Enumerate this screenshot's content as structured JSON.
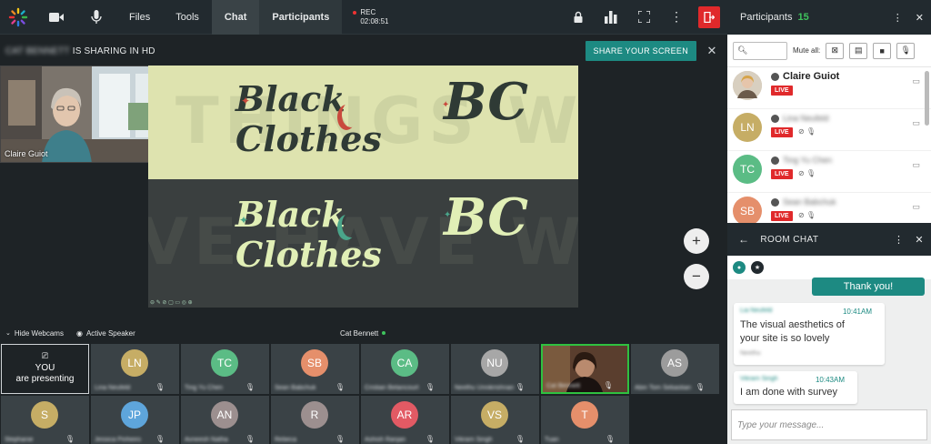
{
  "topbar": {
    "nav": [
      "Files",
      "Tools",
      "Chat",
      "Participants"
    ],
    "rec_label": "REC",
    "rec_time": "02:08:51"
  },
  "share": {
    "sharer_name": "CAT BENNETT",
    "sharing_text": "IS SHARING IN HD",
    "share_button": "SHARE YOUR SCREEN"
  },
  "presenter": {
    "name": "Claire Guiot"
  },
  "slide": {
    "ghost_top": "THINGS WE",
    "ghost_bottom": "VE HAVE WE EH",
    "logo_line1": "Black",
    "logo_line2": "Clothes",
    "monogram": "BC"
  },
  "zoom": {
    "in": "+",
    "out": "−"
  },
  "webcam_bar": {
    "hide_label": "Hide Webcams",
    "speaker_label": "Active Speaker",
    "active_name": "Cat Bennett"
  },
  "you_tile": {
    "line1": "YOU",
    "line2": "are presenting"
  },
  "tiles": [
    {
      "initials": "LN",
      "label": "Lina Neufeld",
      "color": "#c6ad65"
    },
    {
      "initials": "TC",
      "label": "Ting Yu Chen",
      "color": "#5bbc85"
    },
    {
      "initials": "SB",
      "label": "Sean Babchuk",
      "color": "#e58f6b"
    },
    {
      "initials": "CA",
      "label": "Cristian Betancourt",
      "color": "#5bbc85"
    },
    {
      "initials": "NU",
      "label": "Neethu Unnikrishnan",
      "color": "#a7a7a7"
    },
    {
      "initials": "",
      "label": "Cat Bennett",
      "color": "#5a4032"
    },
    {
      "initials": "AS",
      "label": "Abin Tom Sebastian",
      "color": "#9c9c9c"
    },
    {
      "initials": "S",
      "label": "Stephanie",
      "color": "#c6ad65"
    },
    {
      "initials": "JP",
      "label": "Jessica Pinheiro",
      "color": "#5ea5db"
    },
    {
      "initials": "AN",
      "label": "Avneesh Natha",
      "color": "#9c8f8f"
    },
    {
      "initials": "R",
      "label": "Rebeca",
      "color": "#9c8f8f"
    },
    {
      "initials": "AR",
      "label": "Ashish Ranjan",
      "color": "#e25a64"
    },
    {
      "initials": "VS",
      "label": "Vikram Singh",
      "color": "#c6ad65"
    },
    {
      "initials": "T",
      "label": "Tuan",
      "color": "#e58f6b"
    }
  ],
  "participants": {
    "title": "Participants",
    "count": "15",
    "mute_all": "Mute all:",
    "list": [
      {
        "initials": "",
        "name": "Claire Guiot",
        "color": "#c9b89d"
      },
      {
        "initials": "LN",
        "name": "Lina Neufeld",
        "color": "#c6ad65"
      },
      {
        "initials": "TC",
        "name": "Ting Yu Chen",
        "color": "#5bbc85"
      },
      {
        "initials": "SB",
        "name": "Sean Babchuk",
        "color": "#e58f6b"
      }
    ],
    "live_label": "LIVE"
  },
  "chat": {
    "title": "ROOM CHAT",
    "mine": "Thank you!",
    "messages": [
      {
        "sender": "Lia Neufeld",
        "time": "10:41AM",
        "text": "The visual aesthetics of your site is so lovely",
        "suffix": "Neethu"
      },
      {
        "sender": "Vikram Singh",
        "time": "10:43AM",
        "text": "I am done with survey"
      }
    ],
    "placeholder": "Type your message..."
  },
  "colors": {
    "accent": "#1d8a82",
    "live": "#e0292b",
    "bar": "#222a2f"
  }
}
